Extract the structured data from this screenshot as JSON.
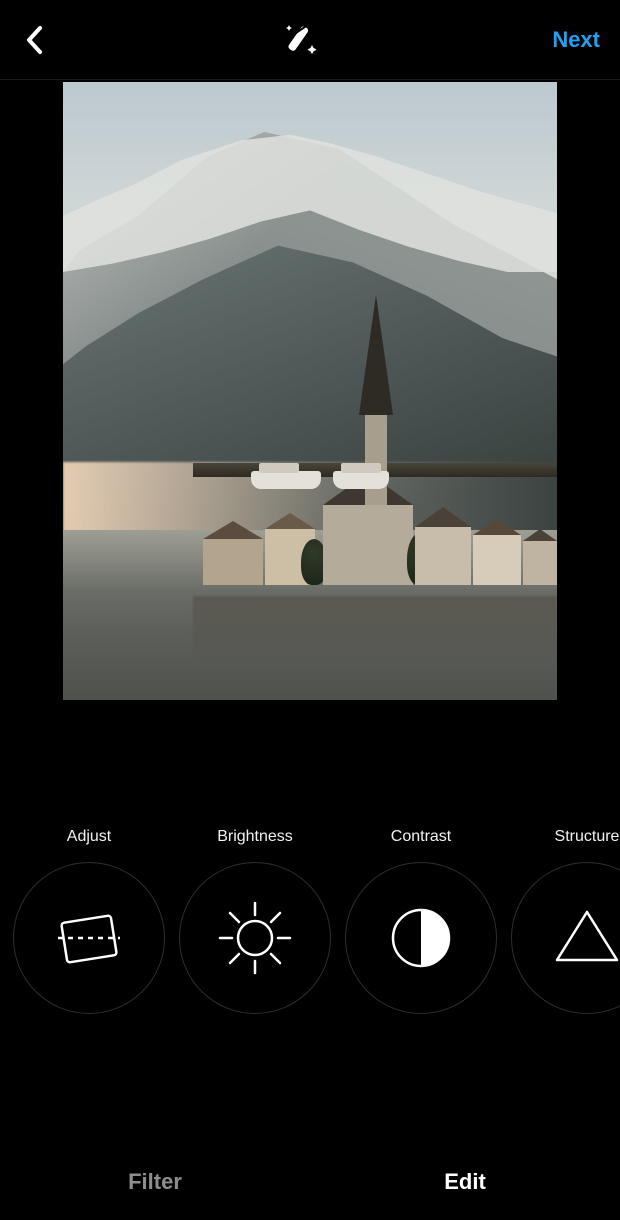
{
  "header": {
    "next_label": "Next"
  },
  "tools": [
    {
      "id": "adjust",
      "label": "Adjust"
    },
    {
      "id": "brightness",
      "label": "Brightness"
    },
    {
      "id": "contrast",
      "label": "Contrast"
    },
    {
      "id": "structure",
      "label": "Structure"
    }
  ],
  "tabs": {
    "filter_label": "Filter",
    "edit_label": "Edit",
    "active": "edit"
  }
}
